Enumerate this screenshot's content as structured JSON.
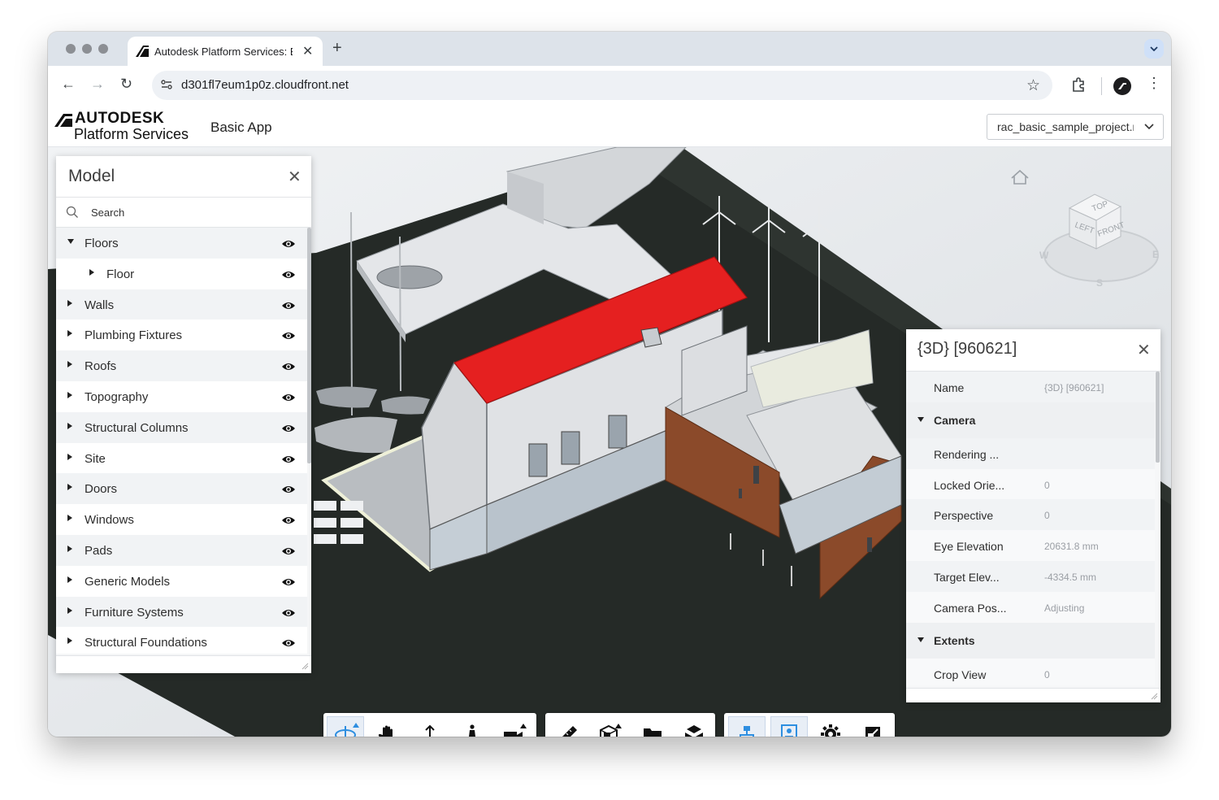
{
  "browser": {
    "tab_title": "Autodesk Platform Services: Basic App",
    "tab_close": "✕",
    "new_tab": "+",
    "url": "d301fl7eum1p0z.cloudfront.net",
    "nav": {
      "back": "←",
      "forward": "→",
      "reload": "↻"
    },
    "star": "☆",
    "menu": "⋮",
    "tab_menu": "⌄"
  },
  "app": {
    "brand_line1": "AUTODESK",
    "brand_line2": "Platform Services",
    "name": "Basic App",
    "project_selected": "rac_basic_sample_project.rvt"
  },
  "model_panel": {
    "title": "Model",
    "close": "✕",
    "search_placeholder": "Search",
    "items": [
      {
        "label": "Floors",
        "expanded": true,
        "level": 0
      },
      {
        "label": "Floor",
        "expanded": false,
        "level": 1
      },
      {
        "label": "Walls",
        "expanded": false,
        "level": 0
      },
      {
        "label": "Plumbing Fixtures",
        "expanded": false,
        "level": 0
      },
      {
        "label": "Roofs",
        "expanded": false,
        "level": 0
      },
      {
        "label": "Topography",
        "expanded": false,
        "level": 0
      },
      {
        "label": "Structural Columns",
        "expanded": false,
        "level": 0
      },
      {
        "label": "Site",
        "expanded": false,
        "level": 0
      },
      {
        "label": "Doors",
        "expanded": false,
        "level": 0
      },
      {
        "label": "Windows",
        "expanded": false,
        "level": 0
      },
      {
        "label": "Pads",
        "expanded": false,
        "level": 0
      },
      {
        "label": "Generic Models",
        "expanded": false,
        "level": 0
      },
      {
        "label": "Furniture Systems",
        "expanded": false,
        "level": 0
      },
      {
        "label": "Structural Foundations",
        "expanded": false,
        "level": 0
      }
    ]
  },
  "properties_panel": {
    "title": "{3D} [960621]",
    "close": "✕",
    "rows": [
      {
        "type": "prop",
        "name": "Name",
        "value": "{3D} [960621]"
      },
      {
        "type": "category",
        "name": "Camera",
        "value": ""
      },
      {
        "type": "prop",
        "name": "Rendering ...",
        "value": ""
      },
      {
        "type": "prop",
        "name": "Locked Orie...",
        "value": "0"
      },
      {
        "type": "prop",
        "name": "Perspective",
        "value": "0"
      },
      {
        "type": "prop",
        "name": "Eye Elevation",
        "value": "20631.8 mm"
      },
      {
        "type": "prop",
        "name": "Target Elev...",
        "value": "-4334.5 mm"
      },
      {
        "type": "prop",
        "name": "Camera Pos...",
        "value": "Adjusting"
      },
      {
        "type": "category",
        "name": "Extents",
        "value": ""
      },
      {
        "type": "prop",
        "name": "Crop View",
        "value": "0"
      }
    ]
  },
  "viewcube": {
    "top": "TOP",
    "left": "LEFT",
    "front": "FRONT",
    "west": "W",
    "east": "E",
    "south": "S"
  },
  "toolbar": {
    "groups": [
      [
        {
          "icon": "orbit-icon",
          "label": "Orbit",
          "active": true
        },
        {
          "icon": "pan-icon",
          "label": "Pan",
          "active": false
        },
        {
          "icon": "zoom-icon",
          "label": "Zoom",
          "active": false
        },
        {
          "icon": "first-person-icon",
          "label": "First Person",
          "active": false
        },
        {
          "icon": "camera-icon",
          "label": "Camera",
          "active": false
        }
      ],
      [
        {
          "icon": "measure-icon",
          "label": "Measure",
          "active": false
        },
        {
          "icon": "section-icon",
          "label": "Section",
          "active": false
        },
        {
          "icon": "model-browser-icon",
          "label": "Model Browser",
          "active": false
        },
        {
          "icon": "explode-icon",
          "label": "Explode",
          "active": false
        }
      ],
      [
        {
          "icon": "structure-icon",
          "label": "Model Structure",
          "active": true
        },
        {
          "icon": "properties-icon",
          "label": "Properties",
          "active": true
        },
        {
          "icon": "settings-icon",
          "label": "Settings",
          "active": false
        },
        {
          "icon": "fullscreen-icon",
          "label": "Full Screen",
          "active": false
        }
      ]
    ]
  },
  "colors": {
    "roof": "#e52020",
    "ground": "#252a27",
    "accent": "#2d8ee0",
    "wall": "#d8dadd",
    "cladding": "#8b4a2a"
  }
}
